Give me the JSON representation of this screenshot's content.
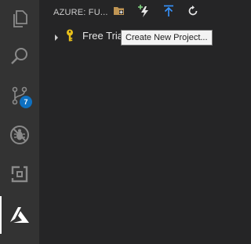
{
  "activity_bar": {
    "items": [
      {
        "icon": "files-icon"
      },
      {
        "icon": "search-icon"
      },
      {
        "icon": "source-control-icon",
        "badge": "7"
      },
      {
        "icon": "debug-icon"
      },
      {
        "icon": "extensions-icon"
      },
      {
        "icon": "azure-icon"
      }
    ],
    "active_index": 5
  },
  "sidebar": {
    "title": "AZURE: FU...",
    "actions": [
      {
        "icon": "new-folder-icon",
        "color": "#c09553"
      },
      {
        "icon": "lightning-plus-icon",
        "color": "#e8e8e8"
      },
      {
        "icon": "deploy-icon",
        "color": "#3794ff"
      },
      {
        "icon": "refresh-icon",
        "color": "#e8e8e8"
      }
    ]
  },
  "tree": {
    "rows": [
      {
        "label": "Free Tria",
        "icon": "key-icon",
        "expanded": false
      }
    ]
  },
  "tooltip": {
    "text": "Create New Project..."
  },
  "colors": {
    "activity_bar_bg": "#333333",
    "sidebar_bg": "#252526",
    "badge_bg": "#0e70c0",
    "key_color": "#e8c01a"
  }
}
